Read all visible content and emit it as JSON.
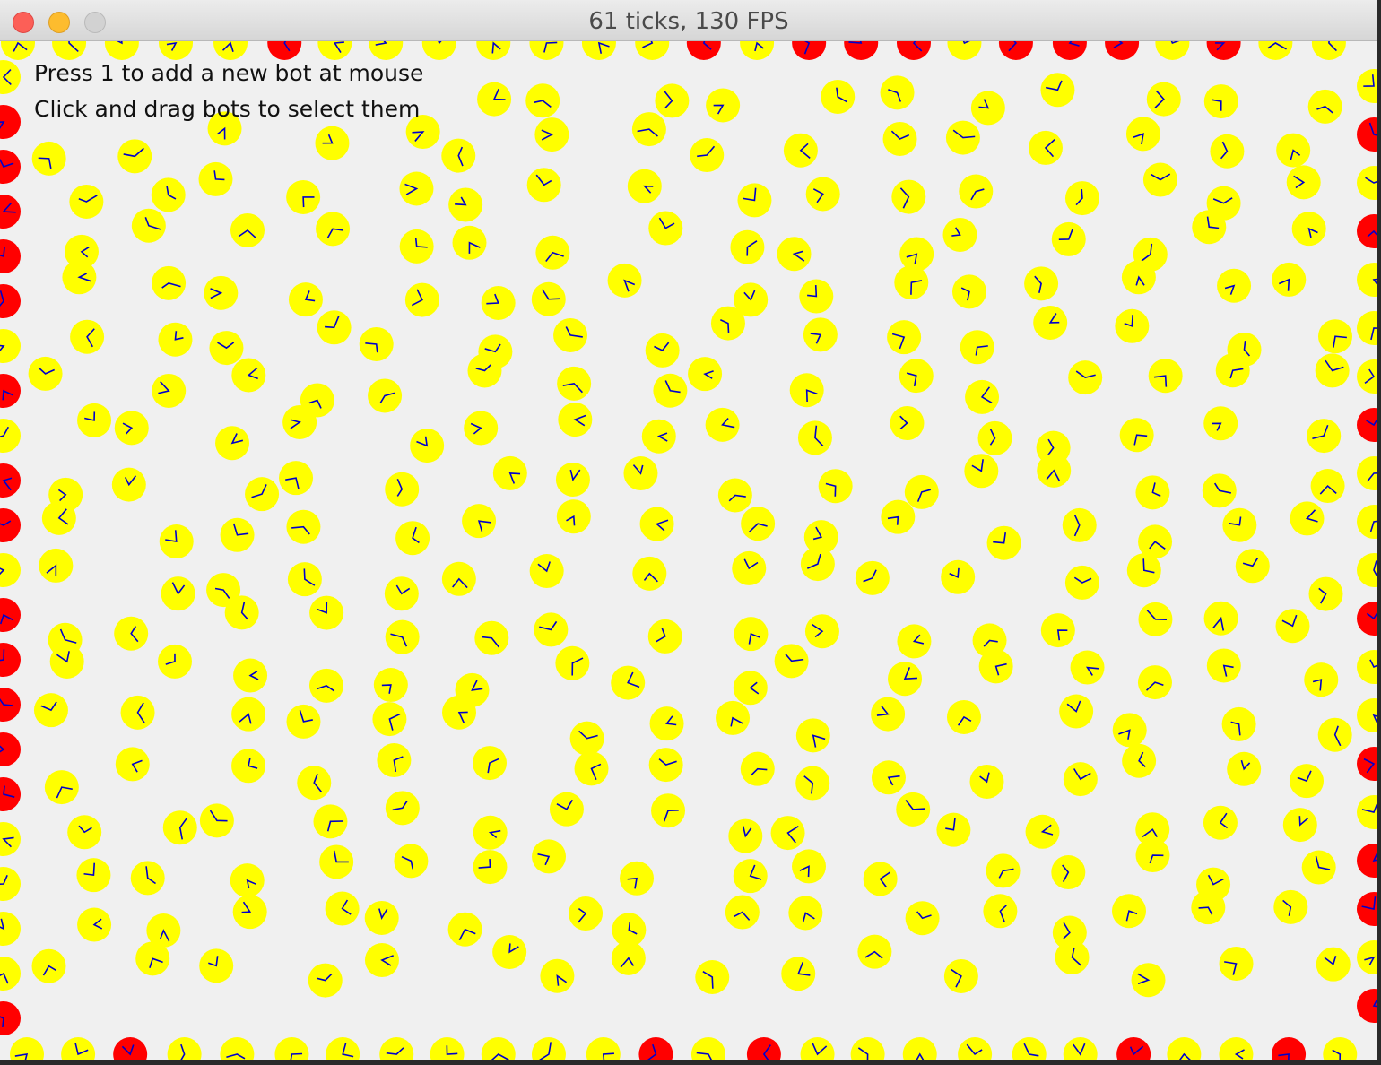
{
  "window": {
    "title": "61 ticks, 130 FPS",
    "controls": [
      "close",
      "minimize",
      "zoom"
    ]
  },
  "instructions": {
    "line1": "Press 1 to add a new bot at mouse",
    "line2": "Click and drag bots to select them"
  },
  "colors": {
    "bot": "#ffff00",
    "bot_edge": "#ff0000",
    "hand": "#0000cc",
    "background": "#f0f0f0"
  }
}
